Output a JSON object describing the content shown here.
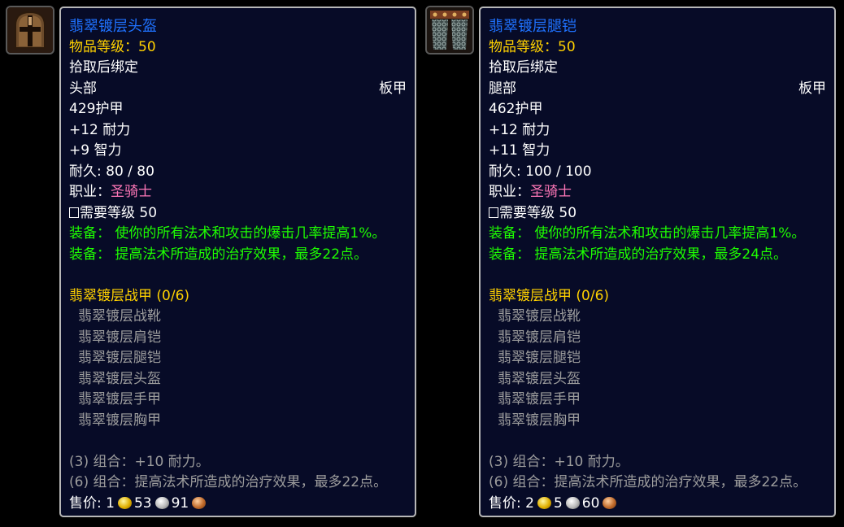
{
  "tooltips": [
    {
      "icon": "plate-helmet-icon",
      "title": "翡翠镀层头盔",
      "item_level": "物品等级：50",
      "binding": "拾取后绑定",
      "slot": "头部",
      "armor_type": "板甲",
      "armor": "429护甲",
      "stat1": "+12 耐力",
      "stat2": "+9 智力",
      "durability": "耐久: 80 / 80",
      "class_label": "职业：",
      "class_value": "圣骑士",
      "level_req": "需要等级 50",
      "equip1": "装备：  使你的所有法术和攻击的爆击几率提高1%。",
      "equip2": "装备：  提高法术所造成的治疗效果，最多22点。",
      "set_name": "翡翠镀层战甲 (0/6)",
      "set_items": [
        "翡翠镀层战靴",
        "翡翠镀层肩铠",
        "翡翠镀层腿铠",
        "翡翠镀层头盔",
        "翡翠镀层手甲",
        "翡翠镀层胸甲"
      ],
      "bonus1": "(3) 组合：+10 耐力。",
      "bonus2": "(6) 组合：提高法术所造成的治疗效果，最多22点。",
      "sell_label": "售价: ",
      "gold": "1",
      "silver": "53",
      "copper": "91"
    },
    {
      "icon": "plate-leggings-icon",
      "title": "翡翠镀层腿铠",
      "item_level": "物品等级：50",
      "binding": "拾取后绑定",
      "slot": "腿部",
      "armor_type": "板甲",
      "armor": "462护甲",
      "stat1": "+12 耐力",
      "stat2": "+11 智力",
      "durability": "耐久: 100 / 100",
      "class_label": "职业：",
      "class_value": "圣骑士",
      "level_req": "需要等级 50",
      "equip1": "装备：  使你的所有法术和攻击的爆击几率提高1%。",
      "equip2": "装备：  提高法术所造成的治疗效果，最多24点。",
      "set_name": "翡翠镀层战甲 (0/6)",
      "set_items": [
        "翡翠镀层战靴",
        "翡翠镀层肩铠",
        "翡翠镀层腿铠",
        "翡翠镀层头盔",
        "翡翠镀层手甲",
        "翡翠镀层胸甲"
      ],
      "bonus1": "(3) 组合：+10 耐力。",
      "bonus2": "(6) 组合：提高法术所造成的治疗效果，最多22点。",
      "sell_label": "售价: ",
      "gold": "2",
      "silver": "5",
      "copper": "60"
    }
  ],
  "colors": {
    "title": "#1f72ff",
    "item_level": "#ffd100",
    "class": "#ff77b8",
    "equip": "#1eff00",
    "set_inactive": "#9d9d9d",
    "background": "#070b27",
    "border": "#b7b7b7"
  }
}
